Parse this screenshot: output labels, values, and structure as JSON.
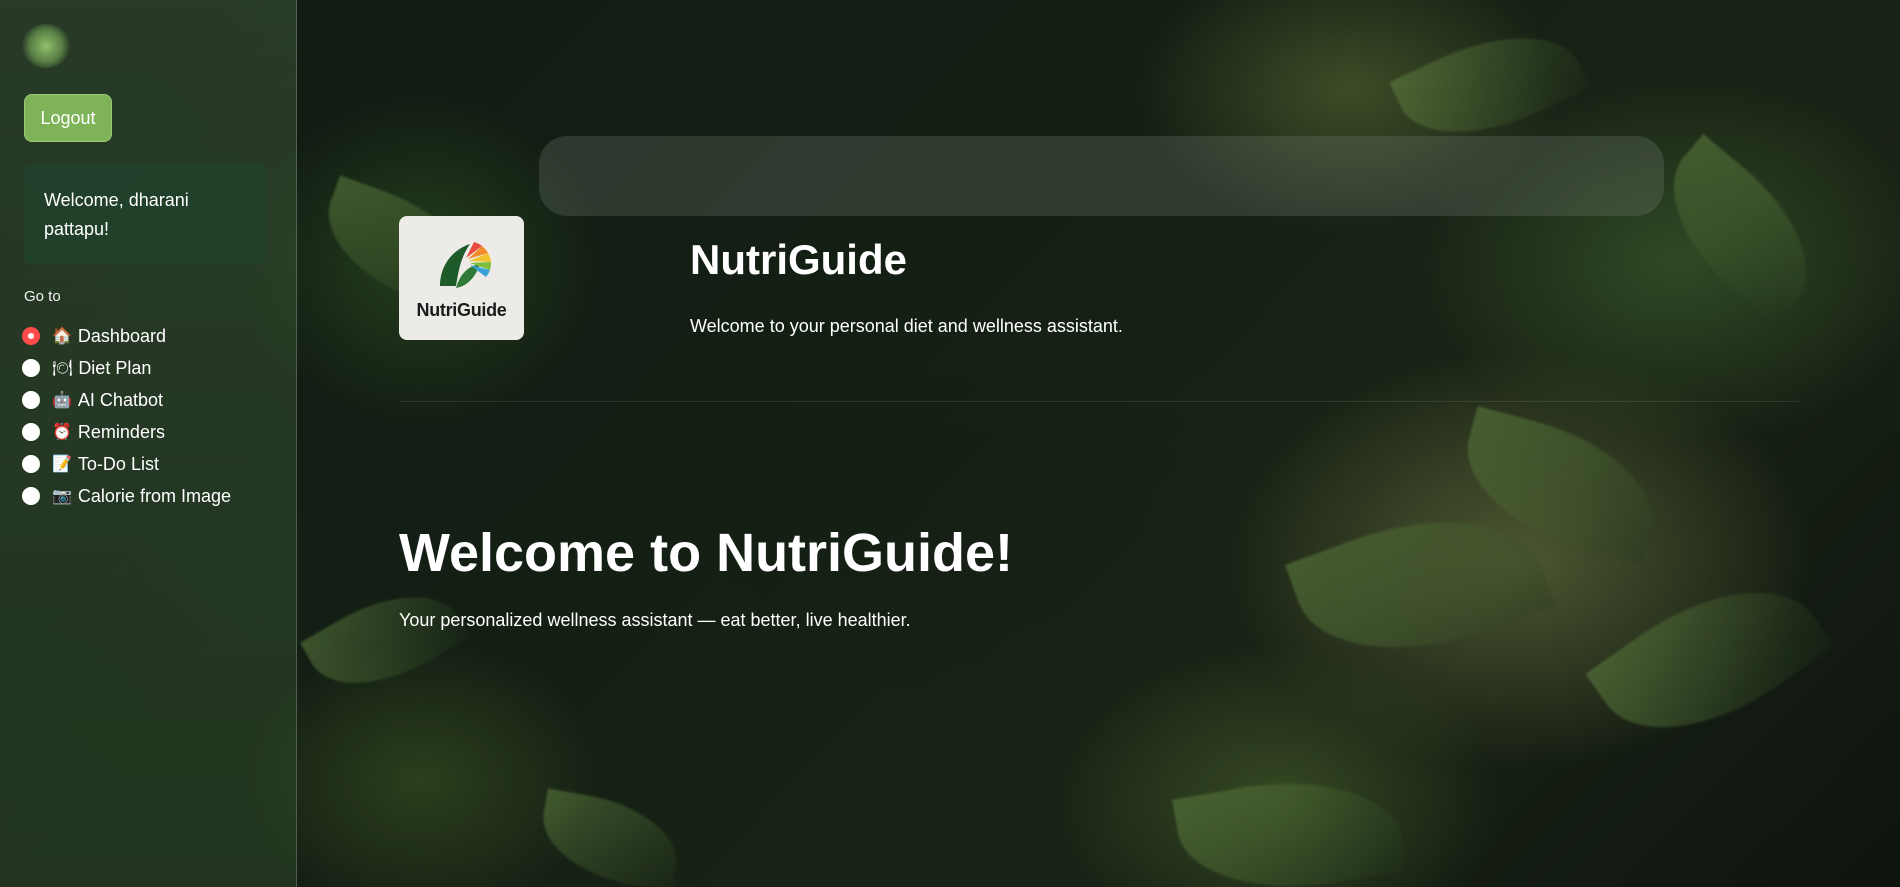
{
  "sidebar": {
    "logout_label": "Logout",
    "welcome_text": "Welcome, dharani pattapu!",
    "goto_label": "Go to",
    "nav_items": [
      {
        "icon": "🏠",
        "icon_name": "house-icon",
        "label": "Dashboard",
        "selected": true
      },
      {
        "icon": "🍽",
        "icon_name": "plate-icon",
        "label": "Diet Plan",
        "selected": false
      },
      {
        "icon": "🤖",
        "icon_name": "robot-icon",
        "label": "AI Chatbot",
        "selected": false
      },
      {
        "icon": "⏰",
        "icon_name": "alarm-clock-icon",
        "label": "Reminders",
        "selected": false
      },
      {
        "icon": "📝",
        "icon_name": "memo-icon",
        "label": "To-Do List",
        "selected": false
      },
      {
        "icon": "📷",
        "icon_name": "camera-icon",
        "label": "Calorie from Image",
        "selected": false
      }
    ]
  },
  "header": {
    "logo_text": "NutriGuide",
    "title": "NutriGuide",
    "subtitle": "Welcome to your personal diet and wellness assistant."
  },
  "main": {
    "hero_title": "Welcome to NutriGuide!",
    "hero_subtitle": "Your personalized wellness assistant — eat better, live healthier."
  },
  "colors": {
    "accent_button": "#7fb357",
    "radio_selected": "#ff4b4b",
    "text": "#ffffff"
  }
}
